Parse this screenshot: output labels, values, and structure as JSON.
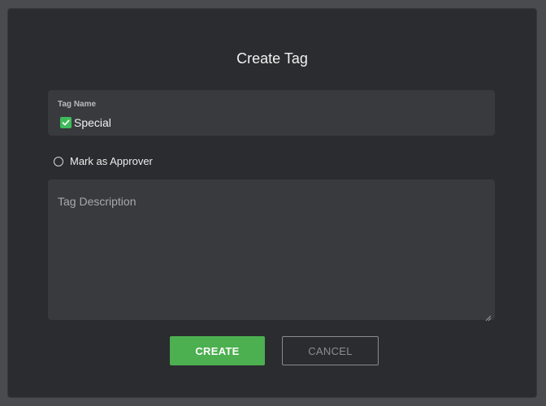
{
  "dialog": {
    "title": "Create Tag"
  },
  "tag_name": {
    "label": "Tag Name",
    "value": "Special",
    "prefix_icon": "check-mark-emoji"
  },
  "approver": {
    "label": "Mark as Approver",
    "checked": false
  },
  "description": {
    "placeholder": "Tag Description",
    "value": ""
  },
  "buttons": {
    "create": "CREATE",
    "cancel": "CANCEL"
  },
  "colors": {
    "dialog_bg": "#2b2c2f",
    "field_bg": "#383a3e",
    "accent_green": "#4caf50",
    "backdrop": "#4a4b4e"
  }
}
